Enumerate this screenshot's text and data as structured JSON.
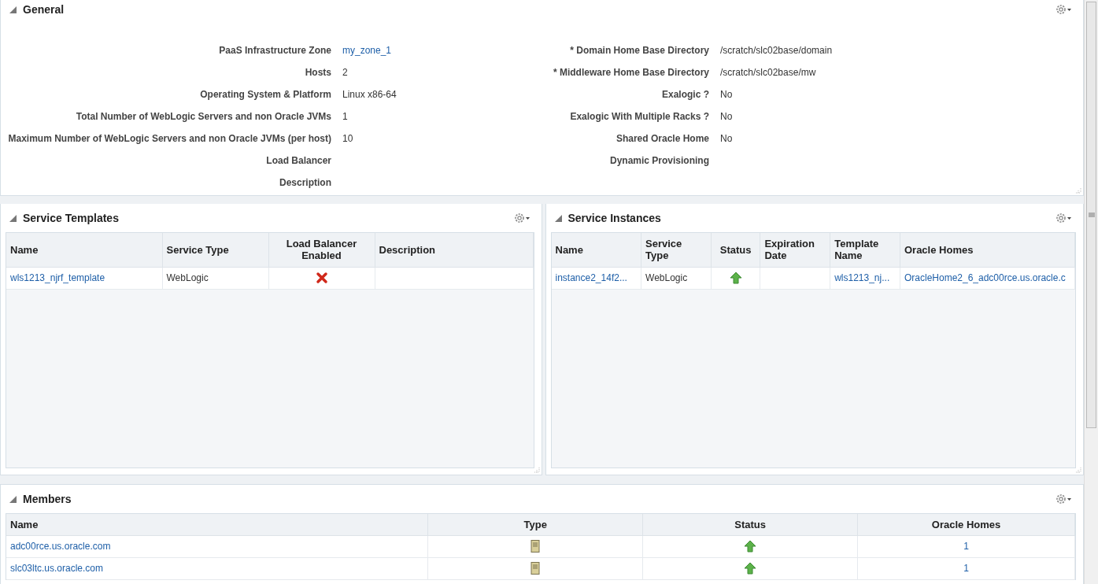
{
  "general": {
    "title": "General",
    "left_fields": [
      {
        "label": "PaaS Infrastructure Zone",
        "value": "my_zone_1",
        "link": true
      },
      {
        "label": "Hosts",
        "value": "2",
        "link": false
      },
      {
        "label": "Operating System & Platform",
        "value": "Linux x86-64",
        "link": false
      },
      {
        "label": "Total Number of WebLogic Servers and non Oracle JVMs",
        "value": "1",
        "link": false
      },
      {
        "label": "Maximum Number of WebLogic Servers and non Oracle JVMs (per host)",
        "value": "10",
        "link": false
      },
      {
        "label": "Load Balancer"
      },
      {
        "label": "Description"
      }
    ],
    "right_fields": [
      {
        "label": "* Domain Home Base Directory",
        "value": "/scratch/slc02base/domain",
        "link": false
      },
      {
        "label": "* Middleware Home Base Directory",
        "value": "/scratch/slc02base/mw",
        "link": false
      },
      {
        "label": "Exalogic ?",
        "value": "No",
        "link": false
      },
      {
        "label": "Exalogic With Multiple Racks ?",
        "value": "No",
        "link": false
      },
      {
        "label": "Shared Oracle Home",
        "value": "No",
        "link": false
      },
      {
        "label": "Dynamic Provisioning"
      }
    ]
  },
  "service_templates": {
    "title": "Service Templates",
    "columns": [
      "Name",
      "Service Type",
      "Load Balancer Enabled",
      "Description"
    ],
    "rows": [
      [
        {
          "kind": "link",
          "text": "wls1213_njrf_template"
        },
        {
          "kind": "text",
          "text": "WebLogic"
        },
        {
          "kind": "flag",
          "enabled": false
        },
        {
          "kind": "blank"
        }
      ]
    ]
  },
  "service_instances": {
    "title": "Service Instances",
    "columns": [
      "Name",
      "Service Type",
      "Status",
      "Expiration Date",
      "Template Name",
      "Oracle Homes"
    ],
    "rows": [
      [
        {
          "kind": "link",
          "text": "instance2_14f2..."
        },
        {
          "kind": "text",
          "text": "WebLogic"
        },
        {
          "kind": "up"
        },
        {
          "kind": "blank"
        },
        {
          "kind": "link",
          "text": "wls1213_nj..."
        },
        {
          "kind": "link",
          "text": "OracleHome2_6_adc00rce.us.oracle.c"
        }
      ]
    ]
  },
  "members": {
    "title": "Members",
    "columns": [
      "Name",
      "Type",
      "Status",
      "Oracle Homes"
    ],
    "rows": [
      [
        {
          "kind": "link",
          "text": "adc00rce.us.oracle.com"
        },
        {
          "kind": "host"
        },
        {
          "kind": "up"
        },
        {
          "kind": "link",
          "text": "1"
        }
      ],
      [
        {
          "kind": "link",
          "text": "slc03ltc.us.oracle.com"
        },
        {
          "kind": "host"
        },
        {
          "kind": "up"
        },
        {
          "kind": "link",
          "text": "1"
        }
      ]
    ]
  }
}
